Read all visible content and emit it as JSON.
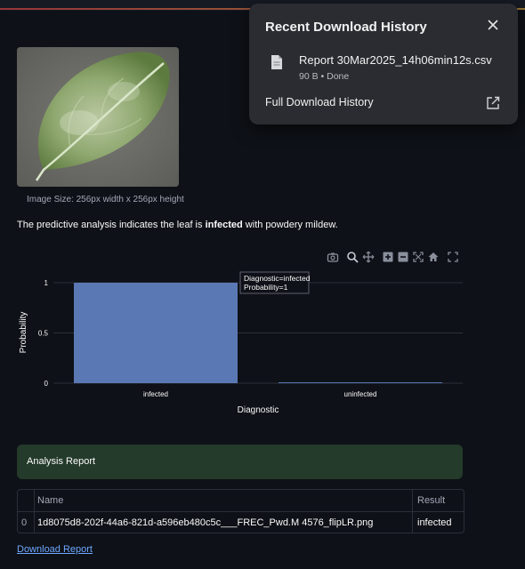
{
  "image": {
    "caption": "Image Size: 256px width x 256px height",
    "description_icon": "leaf-image"
  },
  "analysis": {
    "prefix": "The predictive analysis indicates the leaf is ",
    "status": "infected",
    "suffix": " with powdery mildew."
  },
  "modebar": {
    "icons": [
      "camera-icon",
      "zoom-icon",
      "pan-icon",
      "zoom-in-icon",
      "zoom-out-icon",
      "autoscale-icon",
      "home-icon",
      "fullscreen-icon"
    ]
  },
  "chart_data": {
    "type": "bar",
    "categories": [
      "infected",
      "uninfected"
    ],
    "values": [
      1,
      0
    ],
    "xlabel": "Diagnostic",
    "ylabel": "Probability",
    "ylim": [
      0,
      1
    ],
    "yticks": [
      "0",
      "0.5",
      "1"
    ],
    "grid": true,
    "bar_color": "#5a78b4",
    "tooltip": {
      "line1": "Diagnostic=infected",
      "line2": "Probability=1"
    }
  },
  "report": {
    "title": "Analysis Report",
    "columns": [
      "",
      "Name",
      "Result"
    ],
    "rows": [
      {
        "index": "0",
        "name": "1d8075d8-202f-44a6-821d-a596eb480c5c___FREC_Pwd.M 4576_flipLR.png",
        "result": "infected"
      }
    ]
  },
  "download_link": "Download Report",
  "download_popup": {
    "title": "Recent Download History",
    "file_name": "Report 30Mar2025_14h06min12s.csv",
    "file_meta": "90 B • Done",
    "full_history": "Full Download History"
  },
  "colors": {
    "background": "#0e1117",
    "banner": "#243a2a",
    "bar": "#5a78b4",
    "link": "#6ea8ff",
    "popup": "#2a2c31"
  }
}
